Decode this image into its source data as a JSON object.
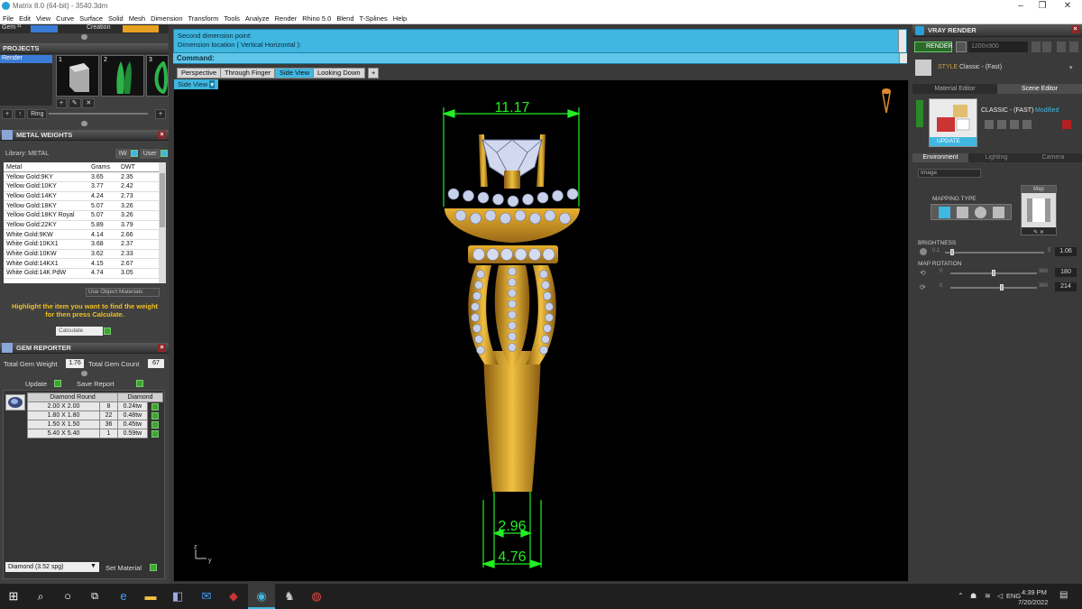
{
  "window": {
    "title": "Matrix 8.0 (64-bit) - 3540.3dm"
  },
  "menu": [
    "File",
    "Edit",
    "View",
    "Curve",
    "Surface",
    "Solid",
    "Mesh",
    "Dimension",
    "Transform",
    "Tools",
    "Analyze",
    "Render",
    "Rhino 5.0",
    "Blend",
    "T-Splines",
    "Help"
  ],
  "left": {
    "toolbar_gem": "Gem ²¹",
    "toolbar_creation": "Creation",
    "projects_title": "PROJECTS",
    "project_item": "Render",
    "thumb_numbers": [
      "1",
      "2",
      "3"
    ],
    "ring_btn": "Ring",
    "metal_title": "METAL WEIGHTS",
    "library_label": "Library: METAL",
    "unit_a": "tW",
    "unit_b": "User",
    "metal_headers": [
      "Metal",
      "Grams",
      "DWT"
    ],
    "metal_rows": [
      [
        "Yellow Gold:9KY",
        "3.65",
        "2.35"
      ],
      [
        "Yellow Gold:10KY",
        "3.77",
        "2.42"
      ],
      [
        "Yellow Gold:14KY",
        "4.24",
        "2.73"
      ],
      [
        "Yellow Gold:18KY",
        "5.07",
        "3.26"
      ],
      [
        "Yellow Gold:18KY Royal",
        "5.07",
        "3.26"
      ],
      [
        "Yellow Gold:22KY",
        "5.89",
        "3.79"
      ],
      [
        "White Gold:9KW",
        "4.14",
        "2.66"
      ],
      [
        "White Gold:10KX1",
        "3.68",
        "2.37"
      ],
      [
        "White Gold:10KW",
        "3.62",
        "2.33"
      ],
      [
        "White Gold:14KX1",
        "4.15",
        "2.67"
      ],
      [
        "White Gold:14K PdW",
        "4.74",
        "3.05"
      ]
    ],
    "use_object_materials": "Use Object Materials",
    "hint": "Highlight the item you want to find the weight for then press Calculate.",
    "calculate": "Calculate",
    "gem_title": "GEM REPORTER",
    "total_weight_label": "Total Gem Weight",
    "total_weight": "1.76",
    "total_count_label": "Total Gem Count",
    "total_count": "67",
    "update": "Update",
    "save_report": "Save Report",
    "gem_headers": [
      "Diamond Round",
      "",
      "Diamond"
    ],
    "gem_rows": [
      [
        "2.00 X 2.00",
        "8",
        "0.24tw"
      ],
      [
        "1.80 X 1.80",
        "22",
        "0.48tw"
      ],
      [
        "1.50 X 1.50",
        "36",
        "0.45tw"
      ],
      [
        "5.40 X 5.40",
        "1",
        "0.59tw"
      ]
    ],
    "material_select": "Diamond    (3.52 spg)",
    "set_material": "Set Material"
  },
  "prompt": {
    "line1": "Second dimension point:",
    "line2": "Dimension location ( Vertical  Horizontal ):",
    "command_label": "Command:"
  },
  "view_tabs": [
    "Perspective",
    "Through Finger",
    "Side View",
    "Looking Down"
  ],
  "view_tab_add": "+",
  "viewport_label": "Side View",
  "dimensions": {
    "top_width": "11.17",
    "shank_inner": "2.96",
    "shank_outer": "4.76"
  },
  "axis": {
    "x": "y",
    "y": "z"
  },
  "right": {
    "title": "VRAY RENDER",
    "render_btn": "RENDER",
    "resolution": "1200x900",
    "style_label": "STYLE",
    "style_value": "Classic - (Fast)",
    "tab_material": "Material Editor",
    "tab_scene": "Scene Editor",
    "preset_name": "CLASSIC - (FAST)",
    "modified": "Modified",
    "update_btn": "UPDATE",
    "subtabs": [
      "Environment",
      "Lighting",
      "Camera"
    ],
    "env_select": "Image",
    "mapping_type": "MAPPING TYPE",
    "map_label": "Map",
    "brightness_label": "BRIGHTNESS",
    "brightness_min": "0.1",
    "brightness_max": "5",
    "brightness_value": "1.06",
    "brightness_fraction": 0.07,
    "map_rotation_label": "MAP ROTATION",
    "rot_min": "0",
    "rot_max": "360",
    "rot1_value": "180",
    "rot1_fraction": 0.5,
    "rot2_value": "214",
    "rot2_fraction": 0.59
  },
  "taskbar": {
    "lang": "ENG",
    "time": "4:39 PM",
    "date": "7/20/2022"
  },
  "colors": {
    "accent": "#3fb7e0",
    "gold": "#d9a520",
    "dimension": "#22ee22",
    "diamond": "#c8d0ea"
  }
}
